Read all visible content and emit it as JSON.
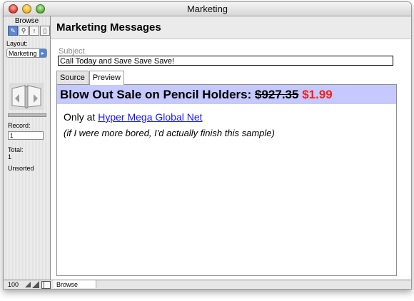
{
  "window": {
    "title": "Marketing"
  },
  "status_area": {
    "mode": "Browse",
    "layout_label": "Layout:",
    "layout_value": "Marketing",
    "record_label": "Record:",
    "record_value": "1",
    "total_label": "Total:",
    "total_value": "1",
    "sort_status": "Unsorted"
  },
  "bottom_bar": {
    "zoom_percent": "100",
    "mode": "Browse"
  },
  "page": {
    "title": "Marketing Messages",
    "subject_label": "Subject",
    "subject_value": "Call Today and Save Save Save!",
    "tabs": [
      {
        "label": "Source"
      },
      {
        "label": "Preview"
      }
    ],
    "preview": {
      "headline": "Blow Out Sale on Pencil Holders:",
      "old_price": "$927.35",
      "new_price": "$1.99",
      "promo_prefix": "Only at",
      "promo_link": "Hyper Mega Global Net",
      "note": "(if I were more bored, I'd actually finish this sample)"
    }
  },
  "colors": {
    "banner": "#c5c9ff",
    "new_price": "#ff1d16",
    "link": "#1516ff"
  }
}
